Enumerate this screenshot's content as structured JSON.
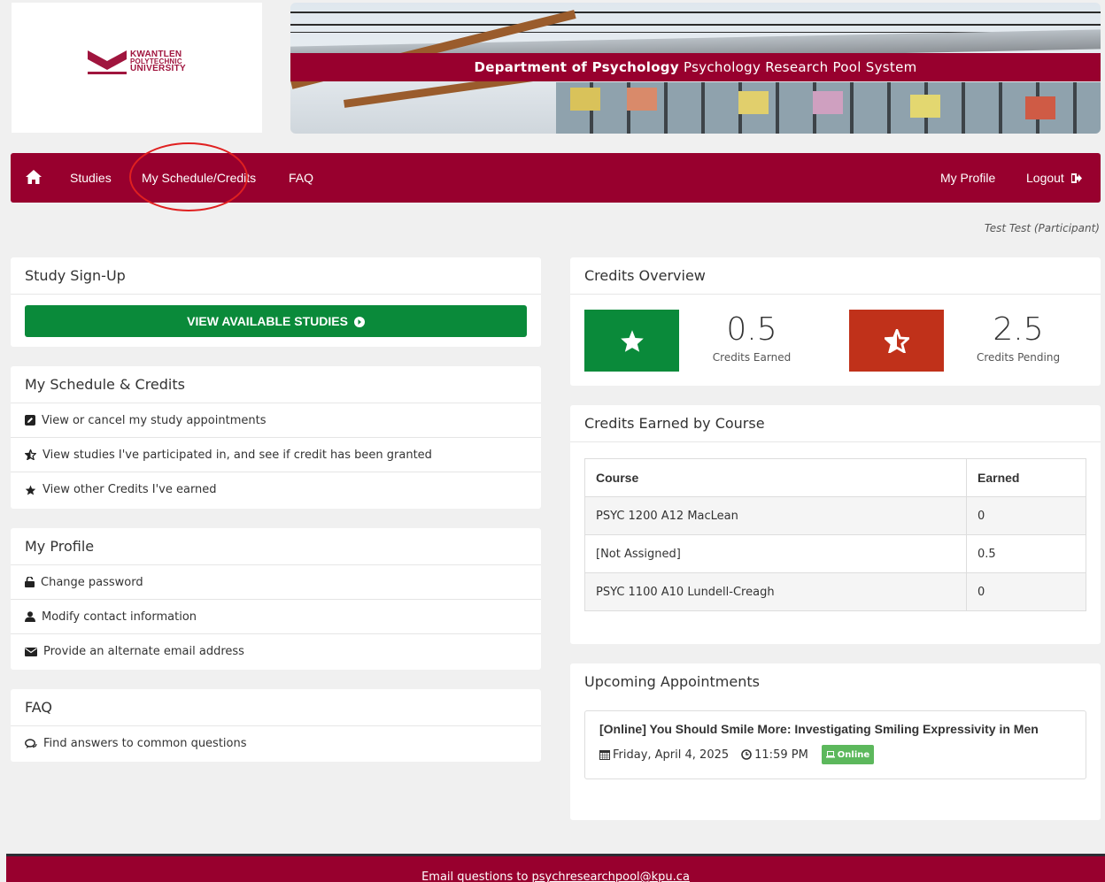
{
  "header": {
    "logo": {
      "line1": "KWANTLEN",
      "line2": "POLYTECHNIC",
      "line3": "UNIVERSITY"
    },
    "banner": {
      "dept": "Department of Psychology",
      "system": "Psychology Research Pool System"
    }
  },
  "nav": {
    "home_icon": "home-icon",
    "left": [
      "Studies",
      "My Schedule/Credits",
      "FAQ"
    ],
    "profile": "My Profile",
    "logout": "Logout",
    "logout_icon": "sign-out-icon"
  },
  "user": {
    "label": "Test Test (Participant)"
  },
  "study_signup": {
    "title": "Study Sign-Up",
    "button": "VIEW AVAILABLE STUDIES"
  },
  "schedule": {
    "title": "My Schedule & Credits",
    "items": [
      {
        "label": "View or cancel my study appointments",
        "icon": "edit-icon"
      },
      {
        "label": "View studies I've participated in, and see if credit has been granted",
        "icon": "half-star-icon"
      },
      {
        "label": "View other Credits I've earned",
        "icon": "star-icon"
      }
    ]
  },
  "profile": {
    "title": "My Profile",
    "items": [
      {
        "label": "Change password",
        "icon": "unlock-icon"
      },
      {
        "label": "Modify contact information",
        "icon": "user-icon"
      },
      {
        "label": "Provide an alternate email address",
        "icon": "envelope-icon"
      }
    ]
  },
  "faq": {
    "title": "FAQ",
    "items": [
      {
        "label": "Find answers to common questions",
        "icon": "comments-icon"
      }
    ]
  },
  "credits_overview": {
    "title": "Credits Overview",
    "earned": {
      "value": "0.5",
      "label": "Credits Earned",
      "color": "#0a8a3a"
    },
    "pending": {
      "value": "2.5",
      "label": "Credits Pending",
      "color": "#c0311a"
    }
  },
  "credits_by_course": {
    "title": "Credits Earned by Course",
    "columns": [
      "Course",
      "Earned"
    ],
    "rows": [
      [
        "PSYC 1200 A12 MacLean",
        "0"
      ],
      [
        "[Not Assigned]",
        "0.5"
      ],
      [
        "PSYC 1100 A10 Lundell-Creagh",
        "0"
      ]
    ]
  },
  "appointments": {
    "title": "Upcoming Appointments",
    "items": [
      {
        "title": "[Online] You Should Smile More: Investigating Smiling Expressivity in Men",
        "date": "Friday, April 4, 2025",
        "time": "11:59 PM",
        "badge": "Online"
      }
    ]
  },
  "footer": {
    "text": "Email questions to ",
    "email": "psychresearchpool@kpu.ca"
  },
  "colors": {
    "brand": "#98002e",
    "green": "#0a8a3a",
    "red": "#c0311a",
    "badge": "#5cb85c"
  }
}
